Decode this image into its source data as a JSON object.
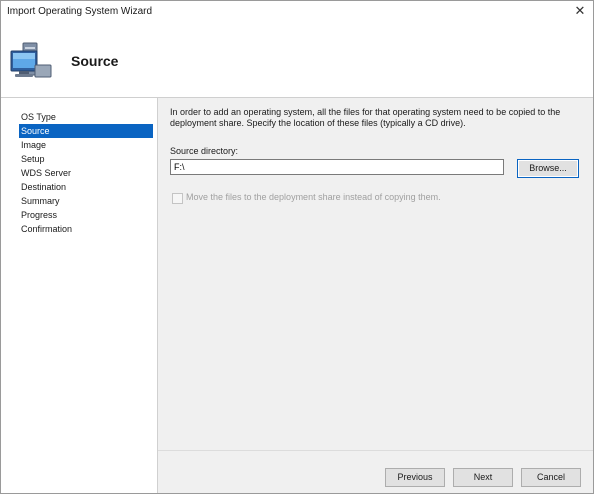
{
  "window": {
    "title": "Import Operating System Wizard",
    "close_glyph": "✕"
  },
  "header": {
    "title": "Source",
    "icon": "computer-icon"
  },
  "nav": {
    "items": [
      {
        "label": "OS Type",
        "active": false
      },
      {
        "label": "Source",
        "active": true
      },
      {
        "label": "Image",
        "active": false
      },
      {
        "label": "Setup",
        "active": false
      },
      {
        "label": "WDS Server",
        "active": false
      },
      {
        "label": "Destination",
        "active": false
      },
      {
        "label": "Summary",
        "active": false
      },
      {
        "label": "Progress",
        "active": false
      },
      {
        "label": "Confirmation",
        "active": false
      }
    ]
  },
  "content": {
    "description": "In order to add an operating system, all the files for that operating system need to be copied to the deployment share.  Specify the location of these files (typically a CD drive).",
    "source_label": "Source directory:",
    "source_value": "F:\\",
    "browse_label": "Browse...",
    "move_label": "Move the files to the deployment share instead of copying them.",
    "move_checked": false,
    "move_enabled": false
  },
  "footer": {
    "previous_label": "Previous",
    "next_label": "Next",
    "cancel_label": "Cancel"
  },
  "colors": {
    "accent": "#0a64c2",
    "panel": "#f0f0f0"
  }
}
